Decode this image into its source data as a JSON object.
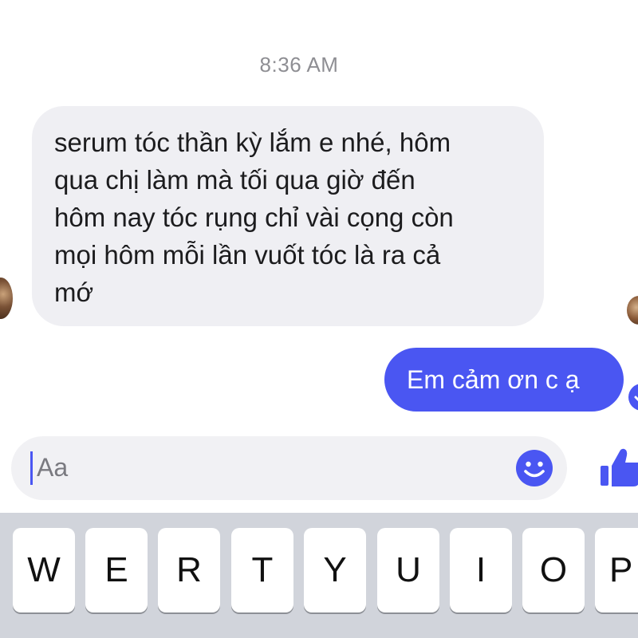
{
  "conversation": {
    "timestamp": "8:36 AM",
    "incoming_message": {
      "lines": [
        "serum tóc thần kỳ lắm e nhé, hôm",
        "qua chị làm mà tối qua giờ đến",
        "hôm nay tóc rụng chỉ vài cọng còn",
        "mọi hôm mỗi lần vuốt tóc là ra cả",
        "mớ"
      ]
    },
    "outgoing_message": {
      "text": "Em cảm ơn c ạ"
    }
  },
  "composer": {
    "placeholder": "Aa",
    "emoji_icon": "smiley-icon",
    "like_icon": "thumbs-up-icon"
  },
  "keyboard": {
    "keys": [
      "W",
      "E",
      "R",
      "T",
      "Y",
      "U",
      "I",
      "O",
      "P"
    ]
  },
  "colors": {
    "accent": "#4a56f2",
    "incoming_bubble": "#efeff3",
    "keyboard_bg": "#d1d4db"
  }
}
